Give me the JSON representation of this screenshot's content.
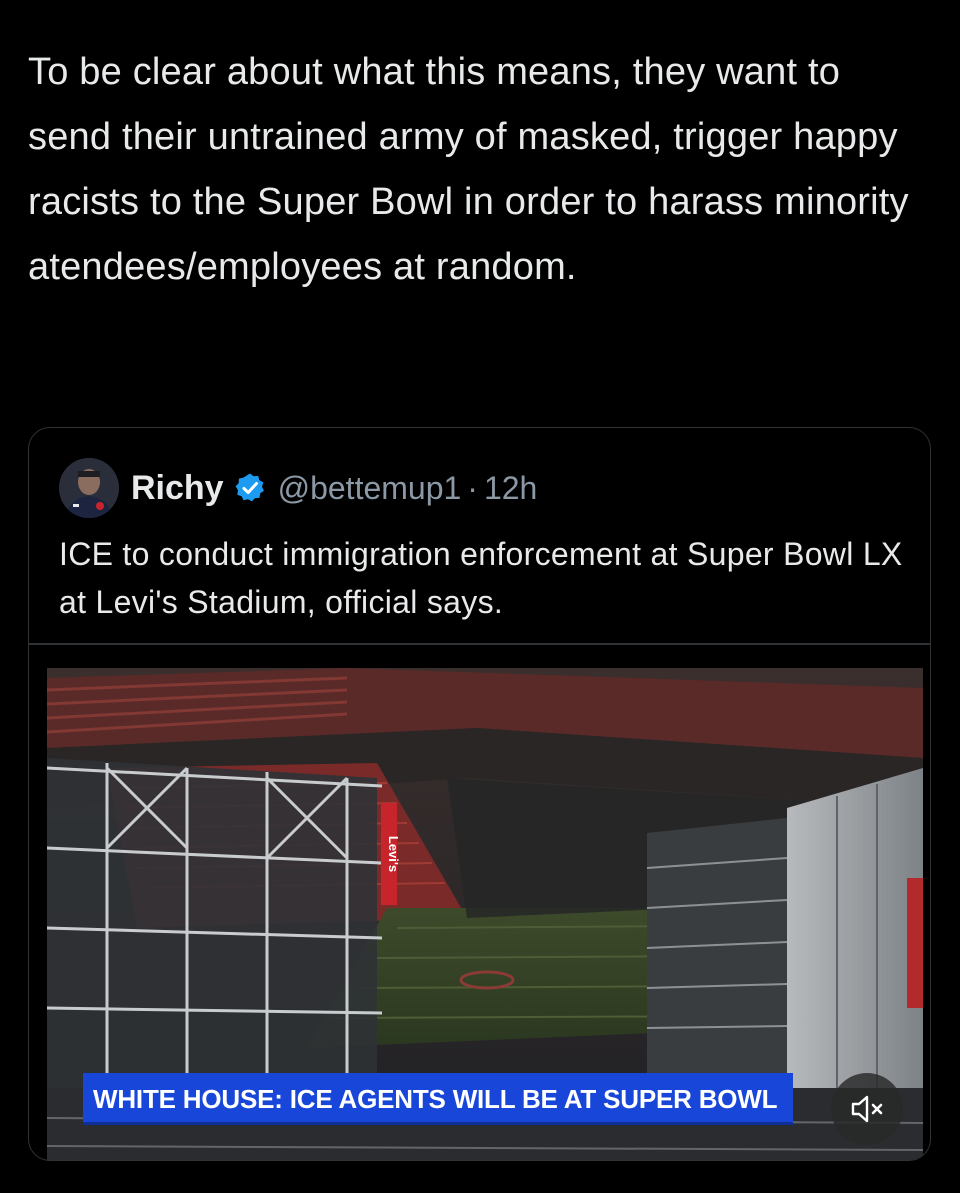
{
  "post": {
    "text": "To be clear about what this means, they want to send their untrained army of masked, trigger happy racists to the Super Bowl in order to harass minority atendees/employees at random."
  },
  "quote": {
    "author_name": "Richy",
    "handle": "@bettemup1",
    "separator": "·",
    "time": "12h",
    "verified_icon": "verified-badge-icon",
    "text": "ICE to conduct immigration enforcement at Super Bowl LX at Levi's Stadium, official says."
  },
  "media": {
    "chyron": "WHITE HOUSE: ICE AGENTS WILL BE AT SUPER BOWL",
    "stadium_sign": "Levi's",
    "mute_icon": "speaker-muted-icon"
  },
  "colors": {
    "background": "#000000",
    "text_primary": "#e7e9ea",
    "text_secondary": "#8b98a5",
    "border": "#2f3336",
    "verified_blue": "#1d9bf0",
    "chyron_blue": "#1746d9"
  }
}
